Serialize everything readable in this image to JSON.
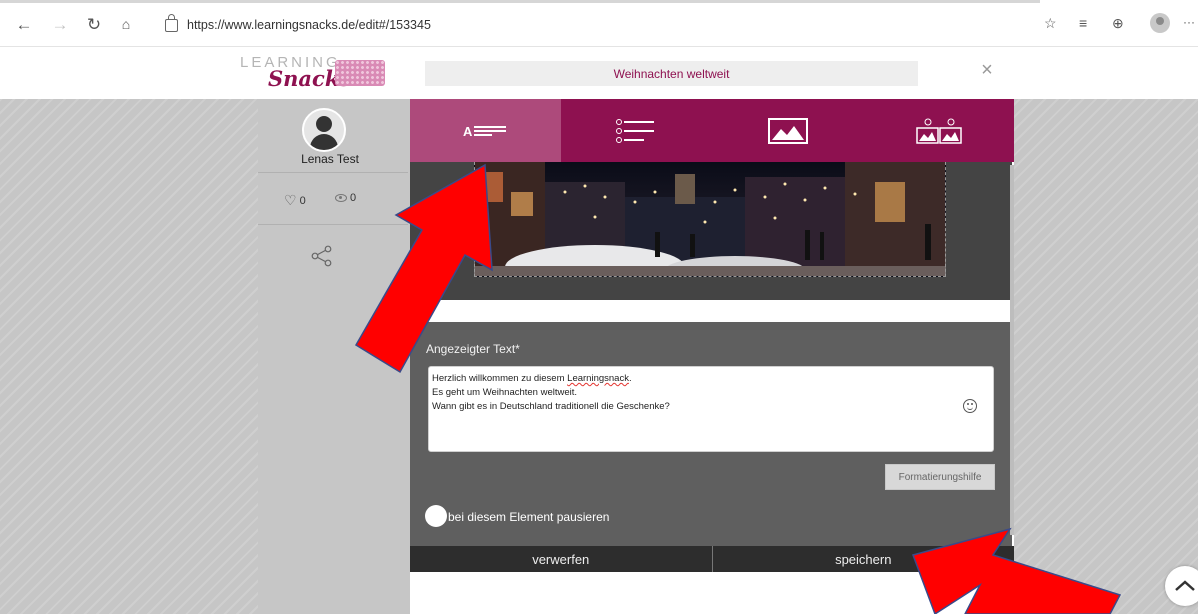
{
  "browser": {
    "url": "https://www.learningsnacks.de/edit#/153345",
    "more_label": "···",
    "icons": [
      "back-icon",
      "forward-icon",
      "reload-icon",
      "home-icon",
      "lock-icon",
      "favorites-add-icon",
      "favorites-icon",
      "collections-icon",
      "profile-icon",
      "more-icon"
    ]
  },
  "logo": {
    "learning": "LEARNING",
    "snacks": "Snacks"
  },
  "sidebar": {
    "user_name": "Lenas Test",
    "likes": "0",
    "views": "0"
  },
  "editor": {
    "title": "Weihnachten weltweit",
    "close_label": "×",
    "tabs": [
      {
        "id": "text",
        "icon": "text-element-icon",
        "active": true
      },
      {
        "id": "quiz",
        "icon": "question-list-icon",
        "active": false
      },
      {
        "id": "image",
        "icon": "image-icon",
        "active": false
      },
      {
        "id": "image-quiz",
        "icon": "image-choice-icon",
        "active": false
      }
    ],
    "text_label": "Angezeigter Text*",
    "text_lines": [
      {
        "before": "Herzlich willkommen zu diesem ",
        "spell": "Learningsnack",
        "after": "."
      },
      {
        "before": "Es geht um Weihnachten weltweit.",
        "spell": "",
        "after": ""
      },
      {
        "before": "Wann gibt es in Deutschland traditionell die Geschenke?",
        "spell": "",
        "after": ""
      }
    ],
    "format_help": "Formatierungshilfe",
    "pause_label": "bei diesem Element pausieren",
    "discard_label": "verwerfen",
    "save_label": "speichern"
  },
  "colors": {
    "brand": "#8e1150",
    "tab_active": "#ad4a7b",
    "annotation_arrow": "#ff0000"
  }
}
